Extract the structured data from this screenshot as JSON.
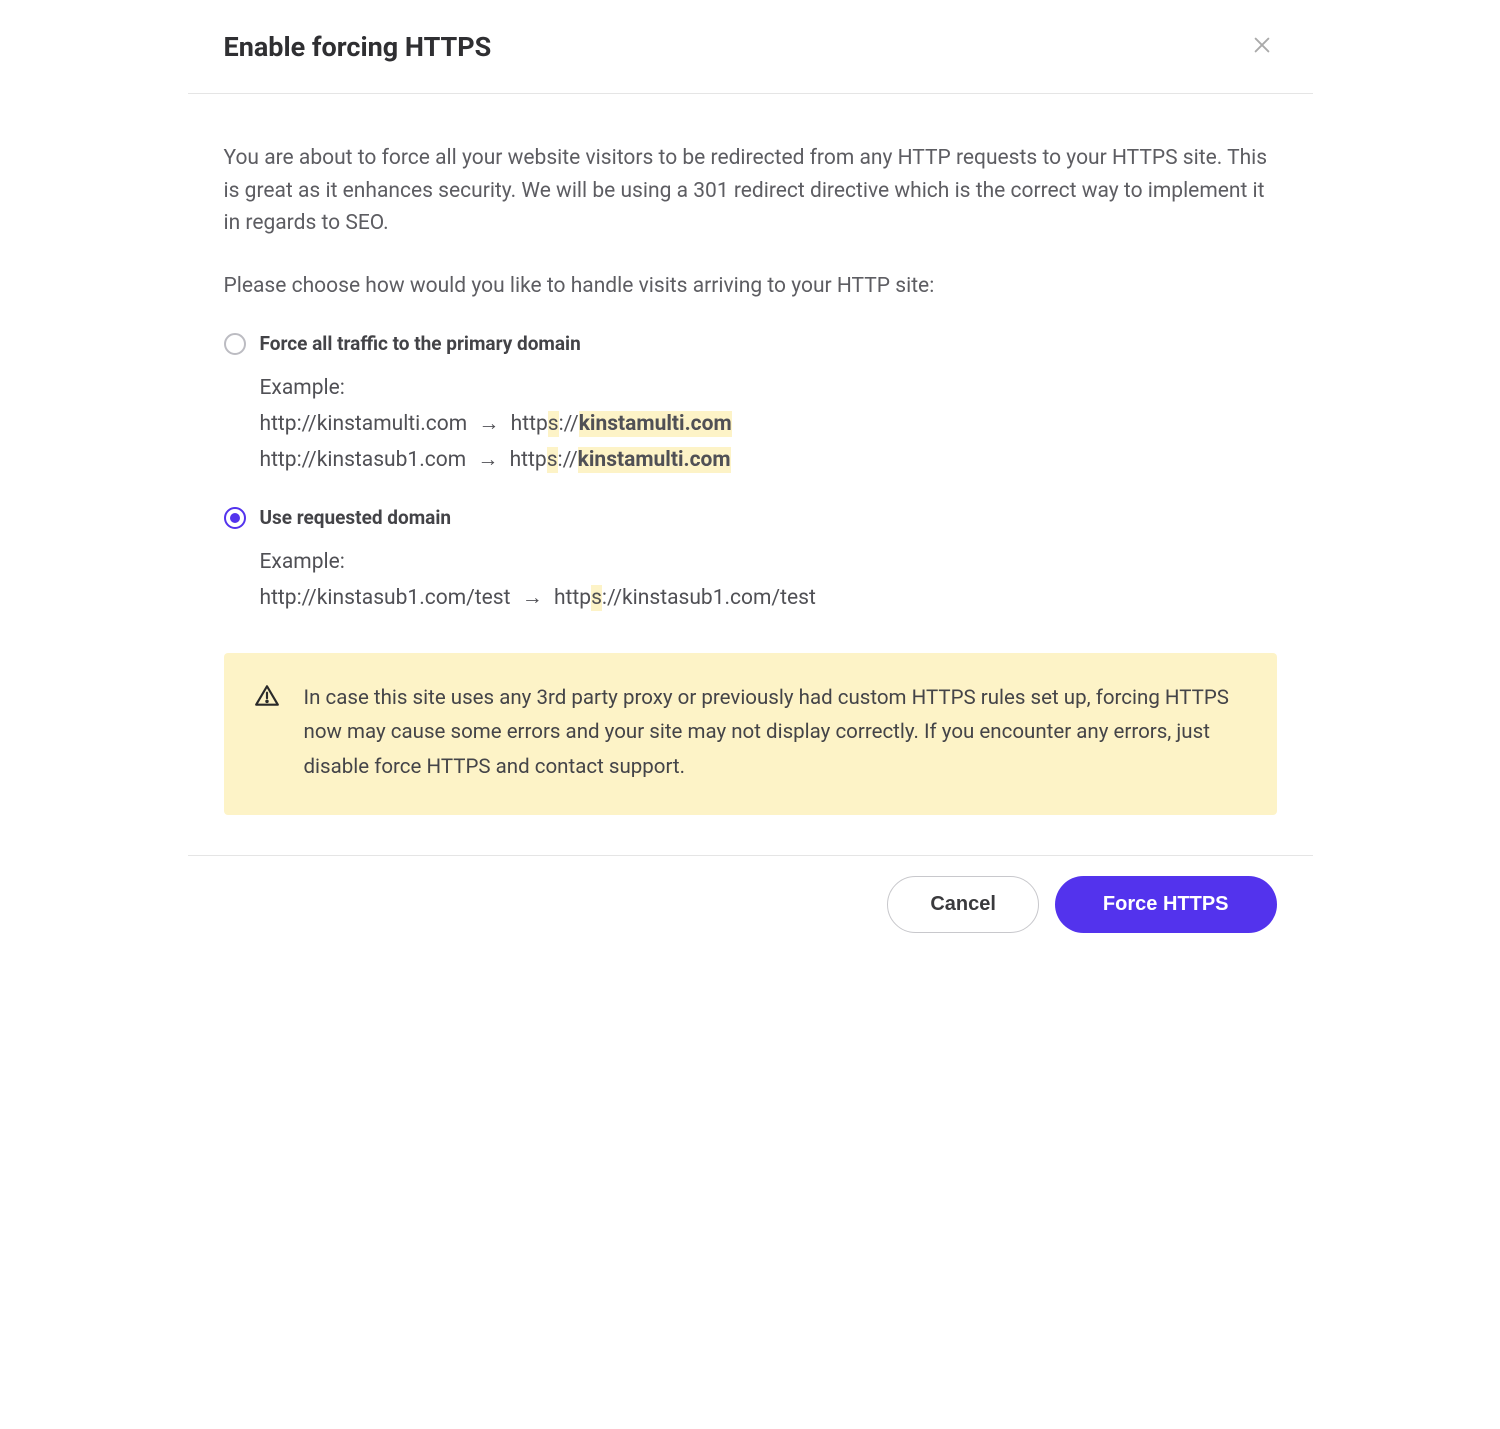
{
  "header": {
    "title": "Enable forcing HTTPS"
  },
  "body": {
    "intro1": "You are about to force all your website visitors to be redirected from any HTTP requests to your HTTPS site. This is great as it enhances security. We will be using a 301 redirect directive which is the correct way to implement it in regards to SEO.",
    "intro2": "Please choose how would you like to handle visits arriving to your HTTP site:"
  },
  "options": [
    {
      "label": "Force all traffic to the primary domain",
      "selected": false,
      "example_label": "Example:",
      "examples": [
        {
          "from": "http://kinstamulti.com",
          "to_prefix": "http",
          "to_s": "s",
          "to_scheme_rest": "://",
          "to_domain": "kinstamulti.com",
          "to_path": "",
          "highlight_domain": true
        },
        {
          "from": "http://kinstasub1.com",
          "to_prefix": "http",
          "to_s": "s",
          "to_scheme_rest": "://",
          "to_domain": "kinstamulti.com",
          "to_path": "",
          "highlight_domain": true
        }
      ]
    },
    {
      "label": "Use requested domain",
      "selected": true,
      "example_label": "Example:",
      "examples": [
        {
          "from": "http://kinstasub1.com/test",
          "to_prefix": "http",
          "to_s": "s",
          "to_scheme_rest": "://kinstasub1.com/test",
          "to_domain": "",
          "to_path": "",
          "highlight_domain": false
        }
      ]
    }
  ],
  "arrow": "→",
  "warning": "In case this site uses any 3rd party proxy or previously had custom HTTPS rules set up, forcing HTTPS now may cause some errors and your site may not display correctly. If you encounter any errors, just disable force HTTPS and contact support.",
  "footer": {
    "cancel": "Cancel",
    "confirm": "Force HTTPS"
  }
}
